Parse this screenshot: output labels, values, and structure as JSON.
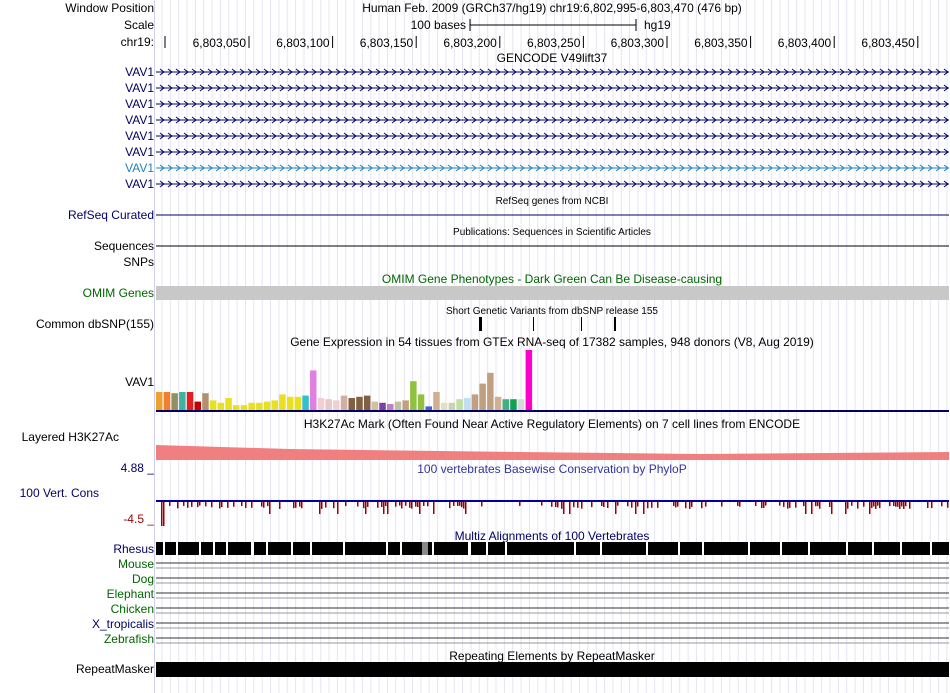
{
  "header": {
    "window_position_label": "Window Position",
    "scale_label": "Scale",
    "chrom_label": "chr19:",
    "assembly_text": "Human Feb. 2009 (GRCh37/hg19)   chr19:6,802,995-6,803,470 (476 bp)",
    "scale_text": "100 bases",
    "scale_db": "hg19",
    "ruler_ticks": [
      "6,803,050",
      "6,803,100",
      "6,803,150",
      "6,803,200",
      "6,803,250",
      "6,803,300",
      "6,803,350",
      "6,803,400",
      "6,803,450"
    ]
  },
  "tracks": {
    "gencode": {
      "title": "GENCODE V49lift37",
      "items": [
        "VAV1",
        "VAV1",
        "VAV1",
        "VAV1",
        "VAV1",
        "VAV1",
        "VAV1",
        "VAV1"
      ],
      "highlight_index": 6
    },
    "refseq": {
      "label": "RefSeq Curated",
      "title": "RefSeq genes from NCBI"
    },
    "sequences": {
      "label": "Sequences",
      "title": "Publications: Sequences in Scientific Articles"
    },
    "snps": {
      "label": "SNPs"
    },
    "omim": {
      "label": "OMIM Genes",
      "title": "OMIM Gene Phenotypes - Dark Green Can Be Disease-causing"
    },
    "dbsnp": {
      "label": "Common dbSNP(155)",
      "title": "Short Genetic Variants from dbSNP release 155"
    },
    "gtex": {
      "label": "VAV1",
      "title": "Gene Expression in 54 tissues from GTEx RNA-seq of 17382 samples, 948 donors (V8, Aug 2019)",
      "bars": [
        {
          "v": 0.3,
          "c": "#f0a030"
        },
        {
          "v": 0.3,
          "c": "#f08030"
        },
        {
          "v": 0.28,
          "c": "#909060"
        },
        {
          "v": 0.3,
          "c": "#40b0a0"
        },
        {
          "v": 0.3,
          "c": "#e02020"
        },
        {
          "v": 0.14,
          "c": "#c00000"
        },
        {
          "v": 0.28,
          "c": "#b09070"
        },
        {
          "v": 0.16,
          "c": "#e8e020"
        },
        {
          "v": 0.12,
          "c": "#e8e020"
        },
        {
          "v": 0.2,
          "c": "#e8e020"
        },
        {
          "v": 0.08,
          "c": "#e8e020"
        },
        {
          "v": 0.08,
          "c": "#e8e020"
        },
        {
          "v": 0.12,
          "c": "#e8e020"
        },
        {
          "v": 0.12,
          "c": "#e8e020"
        },
        {
          "v": 0.14,
          "c": "#e8e020"
        },
        {
          "v": 0.16,
          "c": "#e8e020"
        },
        {
          "v": 0.26,
          "c": "#e8e020"
        },
        {
          "v": 0.22,
          "c": "#e8e020"
        },
        {
          "v": 0.22,
          "c": "#e8e020"
        },
        {
          "v": 0.24,
          "c": "#30c0d0"
        },
        {
          "v": 0.66,
          "c": "#e080e0"
        },
        {
          "v": 0.2,
          "c": "#f0d0d0"
        },
        {
          "v": 0.18,
          "c": "#e8c8c8"
        },
        {
          "v": 0.16,
          "c": "#f0d0d0"
        },
        {
          "v": 0.24,
          "c": "#d0b0a0"
        },
        {
          "v": 0.2,
          "c": "#806040"
        },
        {
          "v": 0.22,
          "c": "#806040"
        },
        {
          "v": 0.24,
          "c": "#806040"
        },
        {
          "v": 0.14,
          "c": "#d0c0a0"
        },
        {
          "v": 0.12,
          "c": "#8040a0"
        },
        {
          "v": 0.1,
          "c": "#c080c0"
        },
        {
          "v": 0.14,
          "c": "#c0c0a0"
        },
        {
          "v": 0.16,
          "c": "#c0a080"
        },
        {
          "v": 0.48,
          "c": "#90c040"
        },
        {
          "v": 0.26,
          "c": "#90c040"
        },
        {
          "v": 0.06,
          "c": "#4060e0"
        },
        {
          "v": 0.3,
          "c": "#d0b090"
        },
        {
          "v": 0.12,
          "c": "#e0e0c0"
        },
        {
          "v": 0.12,
          "c": "#d0d0b0"
        },
        {
          "v": 0.18,
          "c": "#c0e0a0"
        },
        {
          "v": 0.2,
          "c": "#c0e0f0"
        },
        {
          "v": 0.26,
          "c": "#c0a080"
        },
        {
          "v": 0.44,
          "c": "#c0a080"
        },
        {
          "v": 0.62,
          "c": "#c0a080"
        },
        {
          "v": 0.22,
          "c": "#d0b090"
        },
        {
          "v": 0.18,
          "c": "#40b080"
        },
        {
          "v": 0.18,
          "c": "#10a050"
        },
        {
          "v": 0.18,
          "c": "#d8d8d8"
        },
        {
          "v": 1.0,
          "c": "#ff00cc"
        }
      ]
    },
    "h3k27ac": {
      "label": "Layered H3K27Ac",
      "title": "H3K27Ac Mark (Often Found Near Active Regulatory Elements) on 7 cell lines from ENCODE"
    },
    "phylop": {
      "label": "100 Vert. Cons",
      "title": "100 vertebrates Basewise Conservation by PhyloP",
      "max_label": "4.88 _",
      "min_label": "-4.5 _"
    },
    "multiz": {
      "title": "Multiz Alignments of 100 Vertebrates",
      "species": [
        "Rhesus",
        "Mouse",
        "Dog",
        "Elephant",
        "Chicken",
        "X_tropicalis",
        "Zebrafish"
      ]
    },
    "repeatmasker": {
      "label": "RepeatMasker",
      "title": "Repeating Elements by RepeatMasker"
    }
  },
  "colors": {
    "navy": "#000066",
    "green": "#006600",
    "gencode_highlight": "#2080c0",
    "omim_bar": "#c8c8c8",
    "h3k27ac": "#f08080",
    "phylop_pos": "#000099",
    "phylop_neg": "#990000"
  }
}
